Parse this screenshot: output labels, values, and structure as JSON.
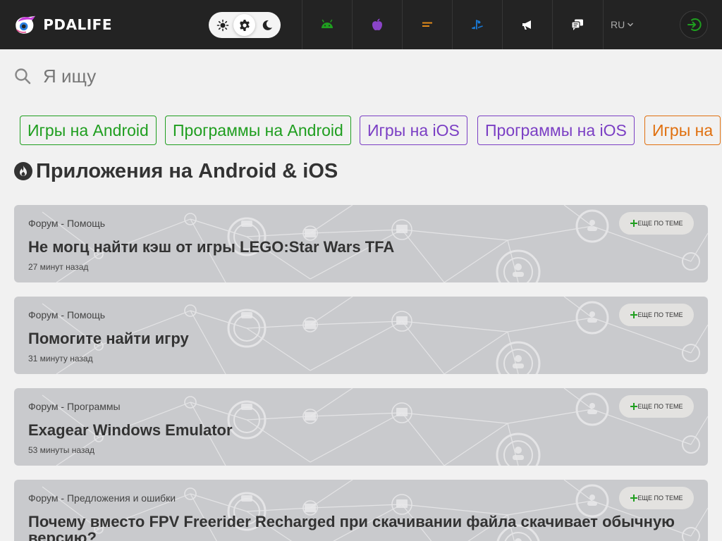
{
  "header": {
    "logo_text": "PDALIFE",
    "theme_options": [
      "light",
      "auto",
      "dark"
    ],
    "nav_icons": [
      "android-icon",
      "apple-icon",
      "news-icon",
      "playstation-icon",
      "megaphone-icon",
      "forum-icon"
    ],
    "lang": "RU",
    "colors": {
      "background": "#232323",
      "android": "#1f9e1f",
      "apple": "#8b44c8",
      "news": "#e08a1a",
      "playstation": "#1a7ad6",
      "login": "#1f9e1f"
    }
  },
  "search": {
    "placeholder": "Я ищу"
  },
  "chips": [
    {
      "label": "Игры на Android",
      "color": "#1f9e1f"
    },
    {
      "label": "Программы на Android",
      "color": "#1f9e1f"
    },
    {
      "label": "Игры на iOS",
      "color": "#7b3fc4"
    },
    {
      "label": "Программы на iOS",
      "color": "#7b3fc4"
    },
    {
      "label": "Игры на",
      "color": "#e0700f"
    }
  ],
  "section": {
    "title": "Приложения на Android & iOS",
    "icon": "fire-icon"
  },
  "more_label": "еще по теме",
  "cards": [
    {
      "category": "Форум - Помощь",
      "title": "Не могц найти кэш от игры LEGO:Star Wars TFA",
      "time": "27 минут назад"
    },
    {
      "category": "Форум - Помощь",
      "title": "Помогите найти игру",
      "time": "31 минуту назад"
    },
    {
      "category": "Форум - Программы",
      "title": "Exagear Windows Emulator",
      "time": "53 минуты назад"
    },
    {
      "category": "Форум - Предложения и ошибки",
      "title": "Почему вместо FPV Freerider Recharged при скачивании файла скачивает обычную версию?",
      "time": ""
    }
  ]
}
